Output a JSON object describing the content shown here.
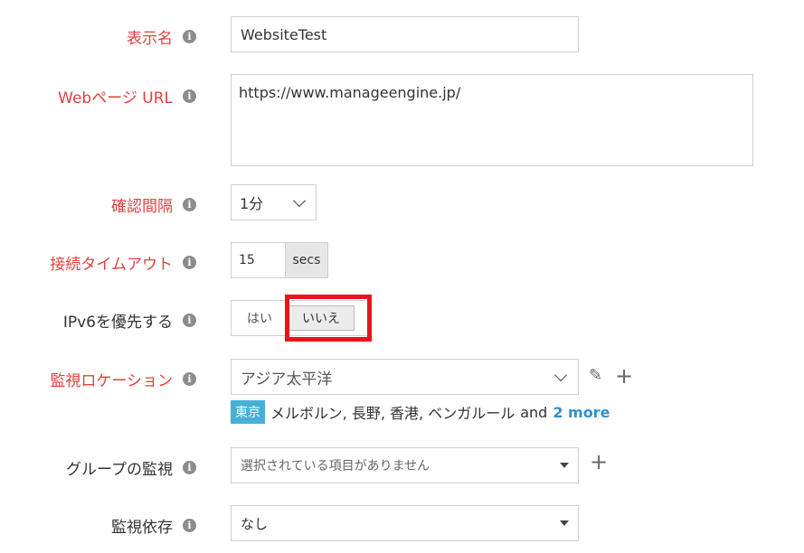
{
  "form": {
    "display_name": {
      "label": "表示名",
      "value": "WebsiteTest"
    },
    "web_url": {
      "label": "Webページ URL",
      "value": "https://www.manageengine.jp/"
    },
    "check_interval": {
      "label": "確認間隔",
      "value": "1分"
    },
    "timeout": {
      "label": "接続タイムアウト",
      "value": "15",
      "unit": "secs"
    },
    "ipv6": {
      "label": "IPv6を優先する",
      "yes": "はい",
      "no": "いいえ",
      "selected": "いいえ"
    },
    "location": {
      "label": "監視ロケーション",
      "value": "アジア太平洋",
      "badge": "東京",
      "others": "メルボルン, 長野, 香港, ベンガルール",
      "and": "and",
      "more": "2 more"
    },
    "group": {
      "label": "グループの監視",
      "placeholder": "選択されている項目がありません"
    },
    "dependency": {
      "label": "監視依存",
      "value": "なし"
    }
  },
  "icons": {
    "info": "i",
    "edit": "✎",
    "add": "+"
  },
  "colors": {
    "required_label": "#e0413e",
    "highlight": "#e8141b",
    "badge": "#47b0d6",
    "link": "#2f8fcf"
  }
}
